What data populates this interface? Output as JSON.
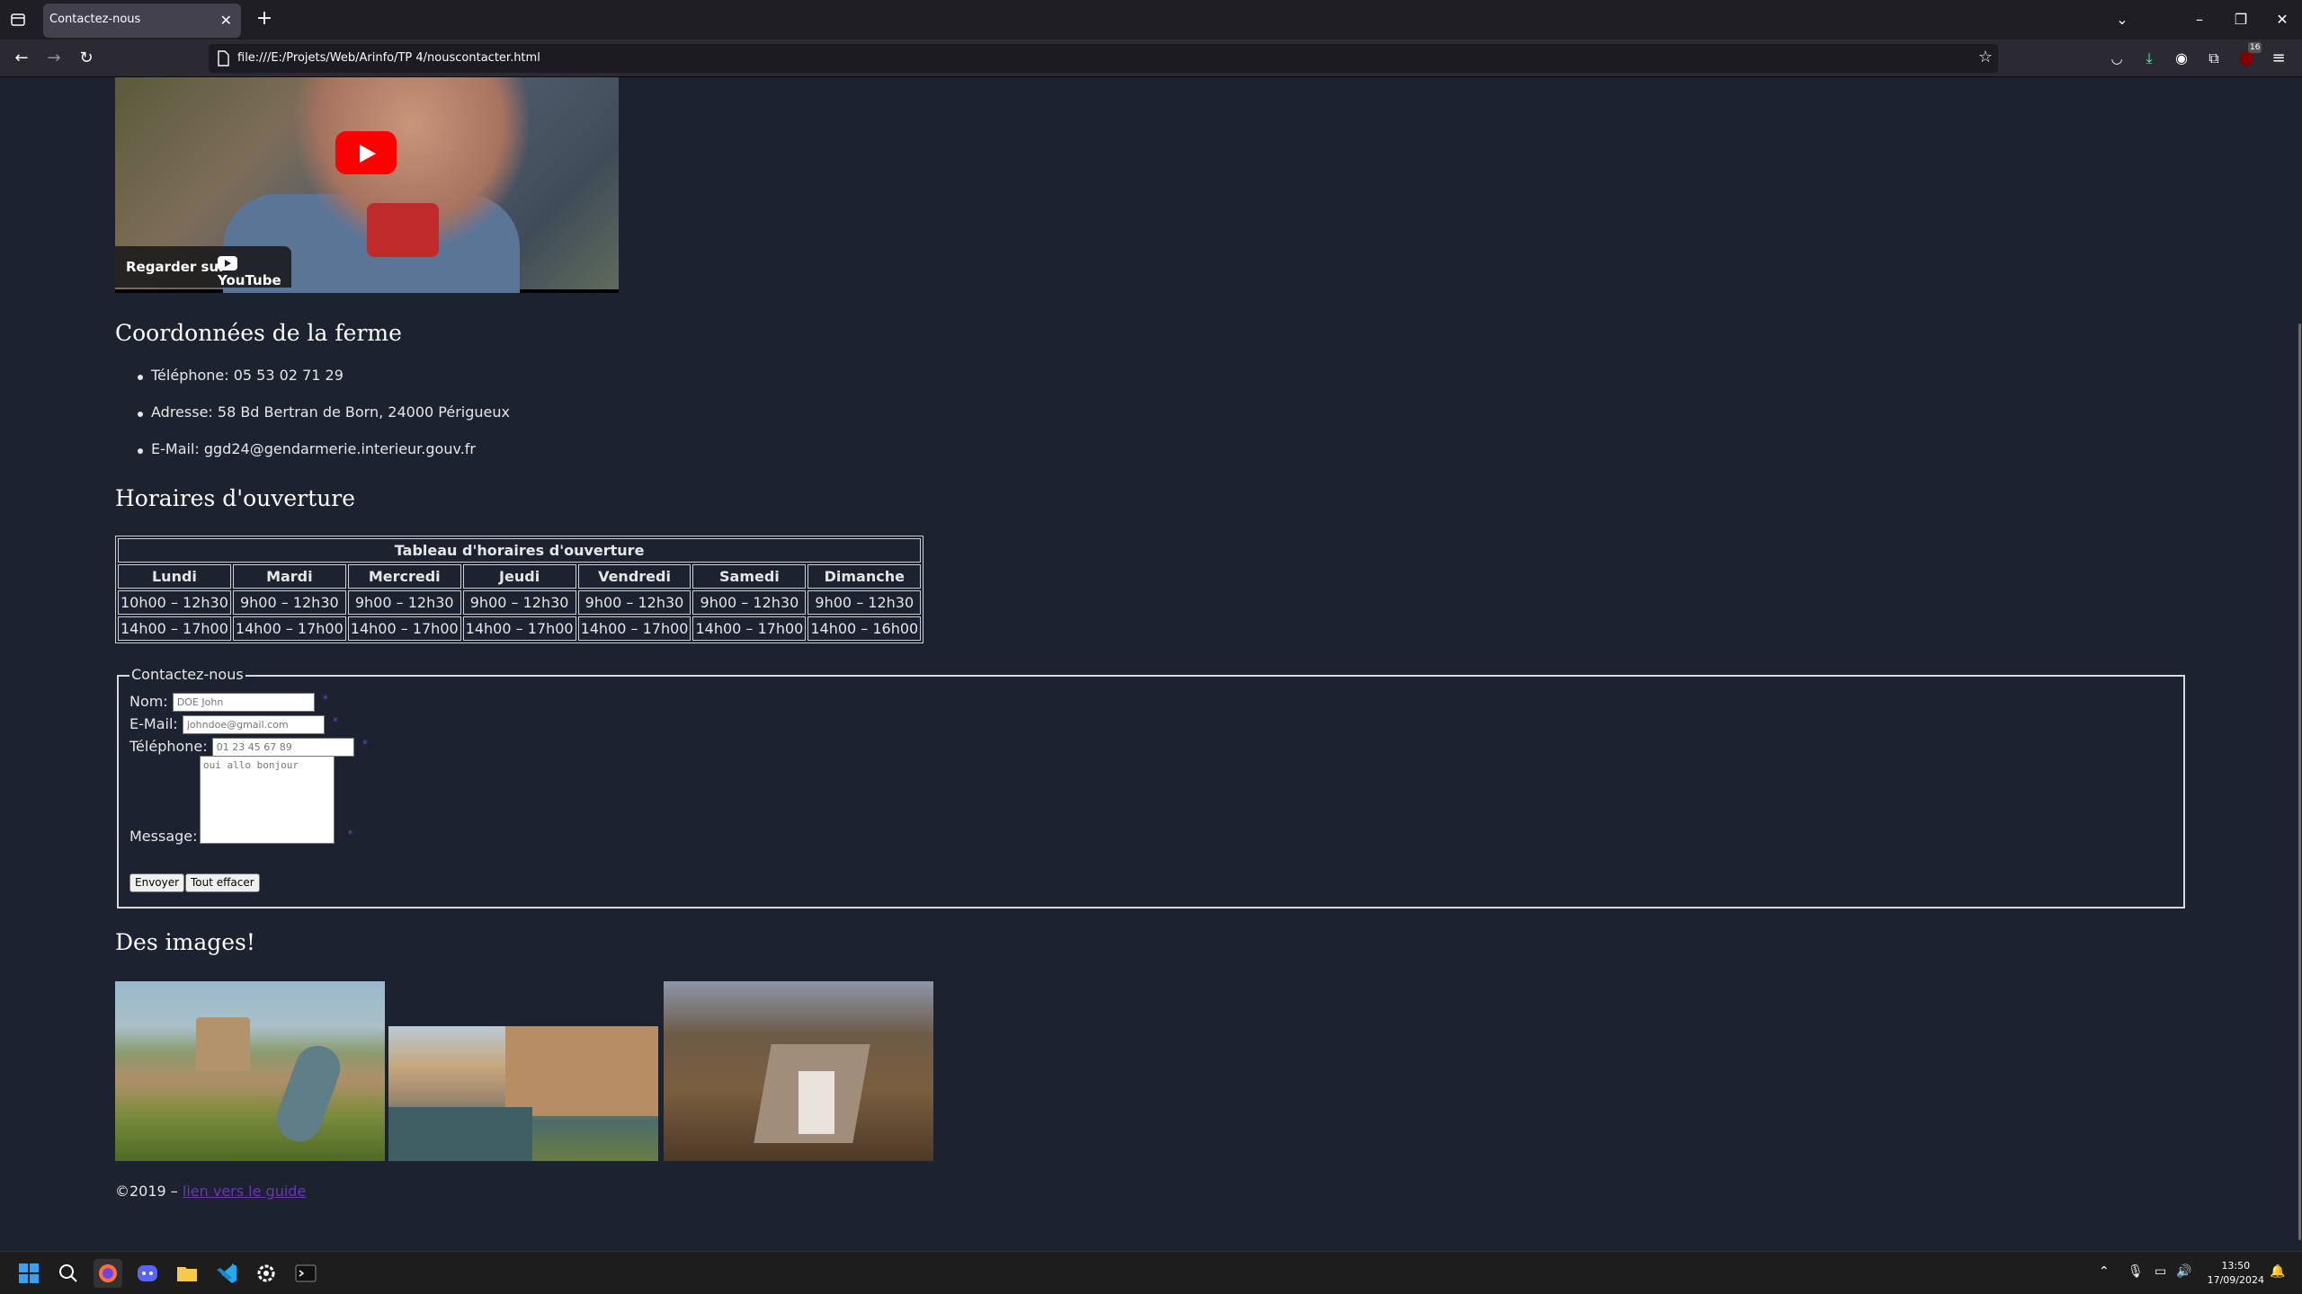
{
  "browser": {
    "tab_title": "Contactez-nous",
    "url": "file:///E:/Projets/Web/Arinfo/TP 4/nouscontacter.html"
  },
  "video": {
    "watch_label": "Regarder sur",
    "platform": "YouTube"
  },
  "coordinates": {
    "heading": "Coordonnées de la ferme",
    "items": [
      "Téléphone: 05 53 02 71 29",
      "Adresse: 58 Bd Bertran de Born, 24000 Périgueux",
      "E-Mail: ggd24@gendarmerie.interieur.gouv.fr"
    ]
  },
  "hours": {
    "heading": "Horaires d'ouverture",
    "caption": "Tableau d'horaires d'ouverture",
    "days": [
      "Lundi",
      "Mardi",
      "Mercredi",
      "Jeudi",
      "Vendredi",
      "Samedi",
      "Dimanche"
    ],
    "morning": [
      "10h00 – 12h30",
      "9h00 – 12h30",
      "9h00 – 12h30",
      "9h00 – 12h30",
      "9h00 – 12h30",
      "9h00 – 12h30",
      "9h00 – 12h30"
    ],
    "afternoon": [
      "14h00 – 17h00",
      "14h00 – 17h00",
      "14h00 – 17h00",
      "14h00 – 17h00",
      "14h00 – 17h00",
      "14h00 – 17h00",
      "14h00 – 16h00"
    ]
  },
  "contact_form": {
    "legend": "Contactez-nous",
    "name_label": "Nom:",
    "name_placeholder": "DOE John",
    "email_label": "E-Mail:",
    "email_placeholder": "johndoe@gmail.com",
    "phone_label": "Téléphone:",
    "phone_placeholder": "01 23 45 67 89",
    "message_label": "Message:",
    "message_placeholder": "oui allo bonjour",
    "required_mark": "*",
    "submit_label": "Envoyer",
    "reset_label": "Tout effacer"
  },
  "images": {
    "heading": "Des images!"
  },
  "footer": {
    "copyright": "©2019 –",
    "link_text": "lien vers le guide"
  },
  "taskbar": {
    "time": "13:50",
    "date": "17/09/2024",
    "notification_count": "16"
  }
}
